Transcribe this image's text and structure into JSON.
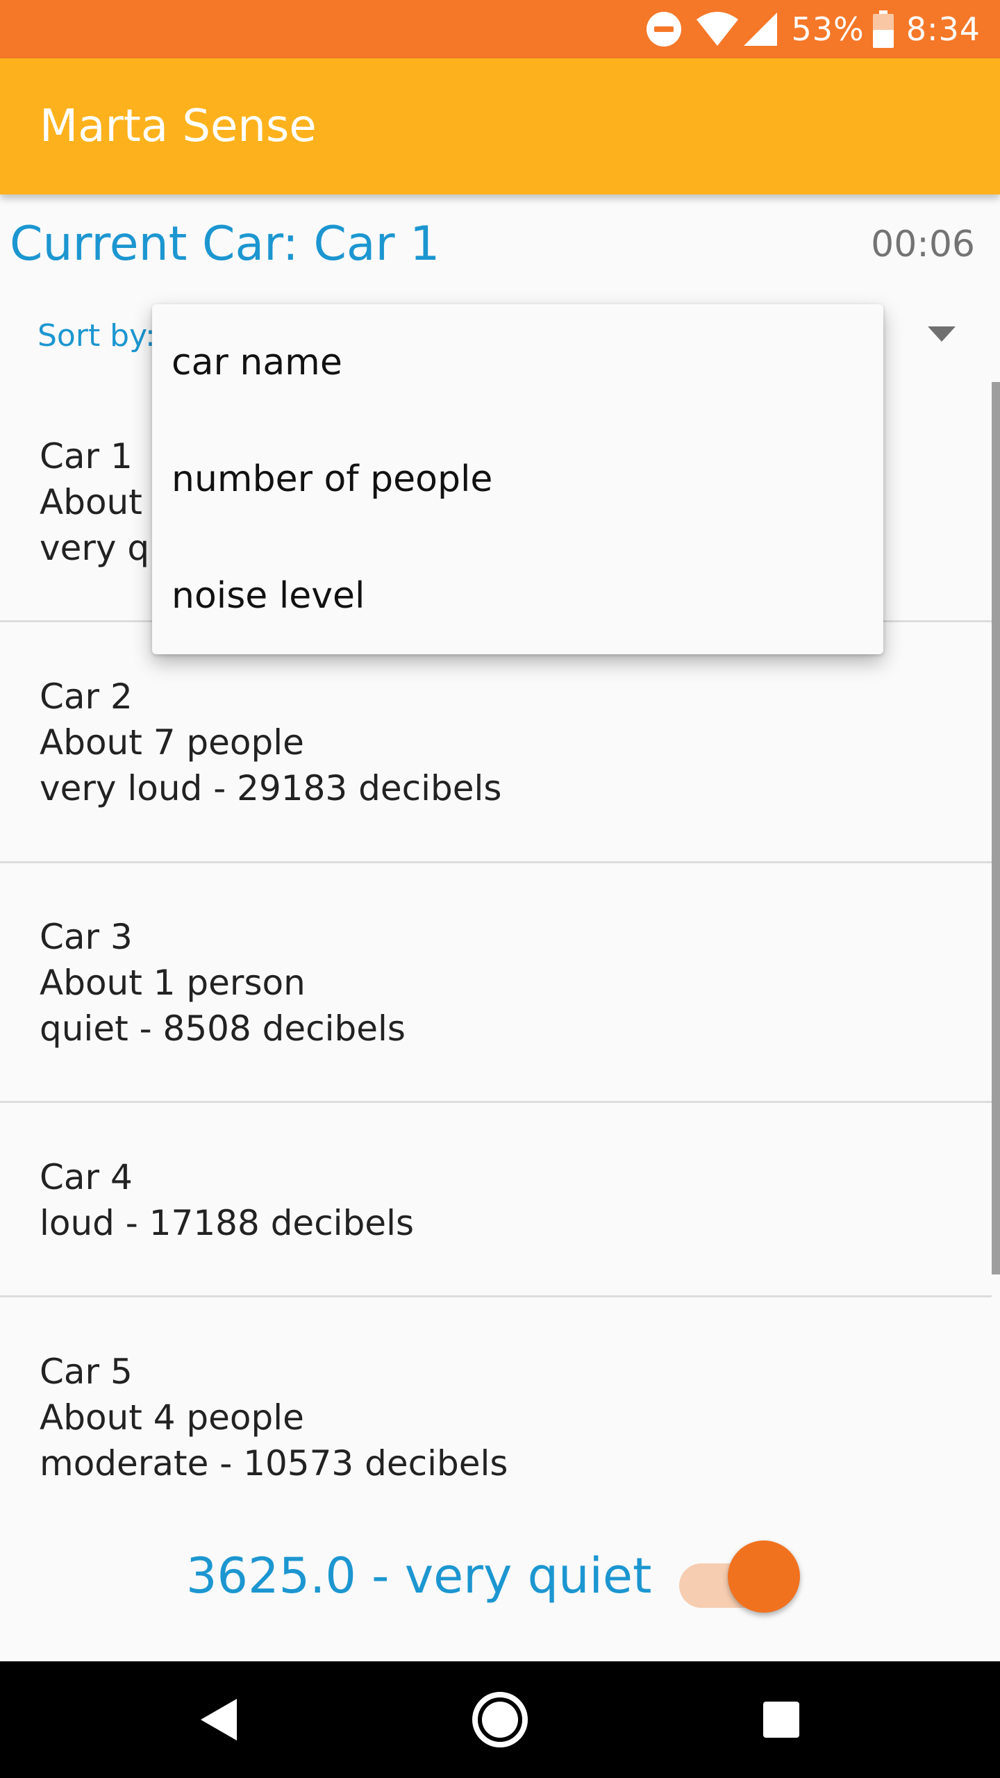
{
  "status_bar": {
    "battery": "53%",
    "time": "8:34",
    "icons": [
      "dnd-icon",
      "wifi-icon",
      "signal-icon",
      "battery-icon"
    ]
  },
  "app_bar": {
    "title": "Marta Sense"
  },
  "current_car": {
    "label": "Current Car: Car 1",
    "timer": "00:06"
  },
  "sort": {
    "label": "Sort by:",
    "options": [
      "car name",
      "number of people",
      "noise level"
    ]
  },
  "cars": [
    {
      "name": "Car 1",
      "people": "About",
      "noise": "very qu"
    },
    {
      "name": "Car 2",
      "people": "About 7 people",
      "noise": "very loud - 29183 decibels"
    },
    {
      "name": "Car 3",
      "people": "About 1 person",
      "noise": "quiet - 8508 decibels"
    },
    {
      "name": "Car 4",
      "noise": "loud - 17188 decibels"
    },
    {
      "name": "Car 5",
      "people": "About 4 people",
      "noise": "moderate - 10573 decibels"
    }
  ],
  "reading": {
    "text": "3625.0 - very quiet",
    "switch_on": true
  },
  "colors": {
    "status_bar": "#f57728",
    "app_bar": "#fdb21d",
    "accent_blue": "#1c96d0",
    "switch_thumb": "#f0721f",
    "switch_track": "#f6cdb1"
  }
}
